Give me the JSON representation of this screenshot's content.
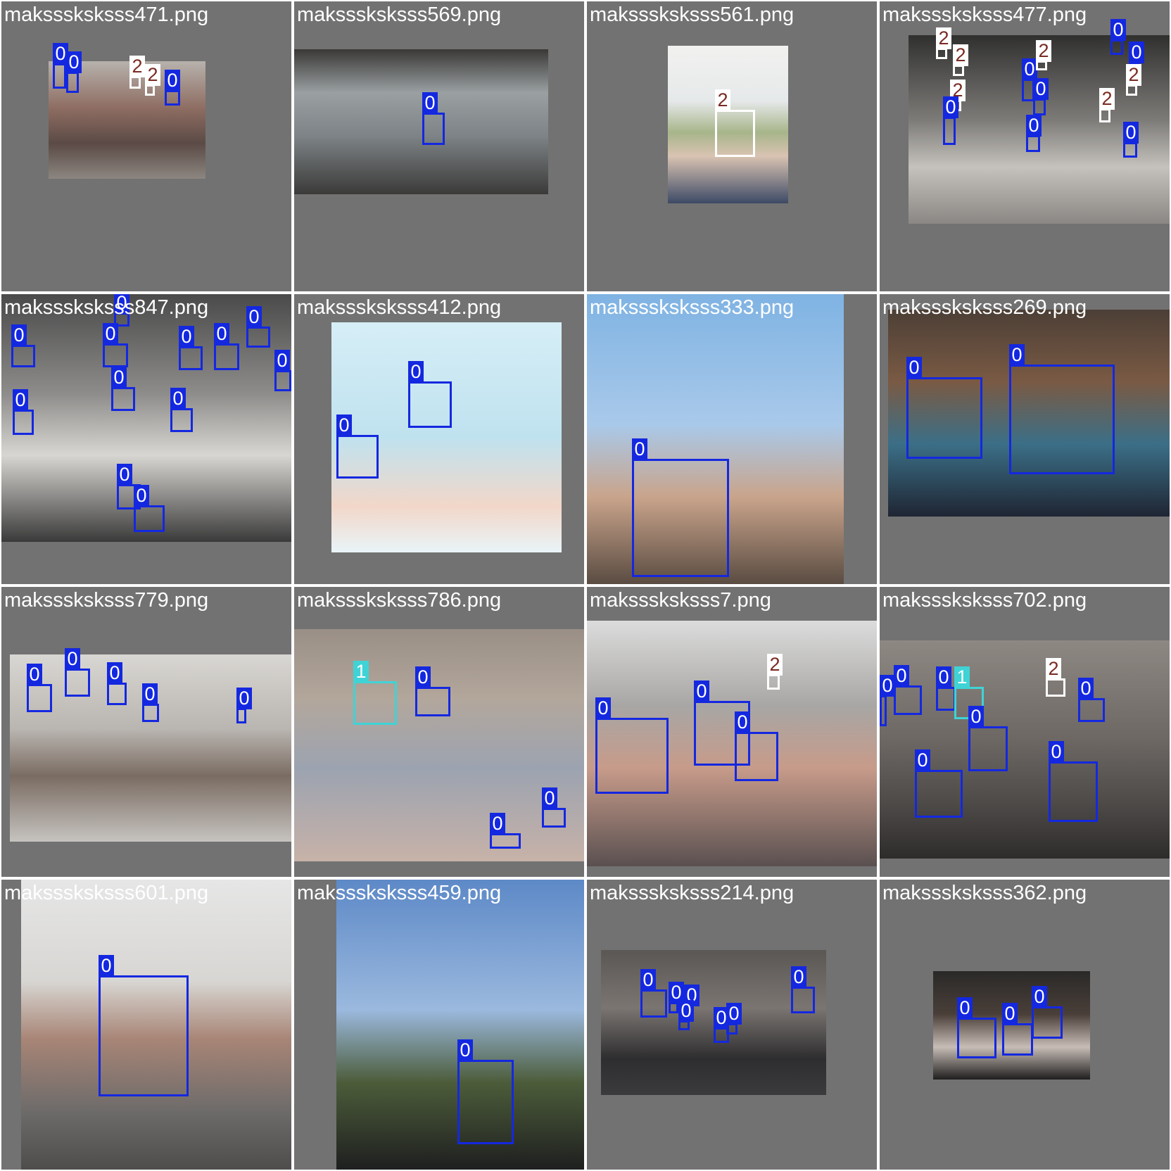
{
  "colors": {
    "class0": "#1428e0",
    "class1": "#3fd3d6",
    "class2": "#ffffff",
    "tile_bg": "#727272"
  },
  "tiles": [
    {
      "filename": "maksssksksss471.png",
      "photo_bg": "linear-gradient(180deg,#b7b2ad 0%,#8e6d62 40%,#5b4a45 70%,#8c8680 100%)",
      "boxes": [
        {
          "label": "0",
          "cls": 0
        },
        {
          "label": "0",
          "cls": 0
        },
        {
          "label": "2",
          "cls": 2
        },
        {
          "label": "2",
          "cls": 2
        },
        {
          "label": "0",
          "cls": 0
        }
      ]
    },
    {
      "filename": "maksssksksss569.png",
      "photo_bg": "linear-gradient(180deg,#3a3836 0%,#9aa0a2 30%,#7d8386 60%,#3b3a39 100%)",
      "boxes": [
        {
          "label": "0",
          "cls": 0
        }
      ]
    },
    {
      "filename": "maksssksksss561.png",
      "photo_bg": "linear-gradient(180deg,#f1f1ef 0%,#e6e9ea 35%,#a7b58a 55%,#d9c3b2 70%,#3d4a66 100%)",
      "boxes": [
        {
          "label": "2",
          "cls": 2
        }
      ]
    },
    {
      "filename": "maksssksksss477.png",
      "photo_bg": "linear-gradient(180deg,#30302f 0%,#7d7b78 45%,#c5c2bd 70%,#8a8784 100%)",
      "boxes": [
        {
          "label": "2",
          "cls": 2
        },
        {
          "label": "2",
          "cls": 2
        },
        {
          "label": "2",
          "cls": 2
        },
        {
          "label": "0",
          "cls": 0
        },
        {
          "label": "0",
          "cls": 0
        },
        {
          "label": "0",
          "cls": 0
        },
        {
          "label": "2",
          "cls": 2
        },
        {
          "label": "0",
          "cls": 0
        },
        {
          "label": "0",
          "cls": 0
        },
        {
          "label": "0",
          "cls": 0
        },
        {
          "label": "2",
          "cls": 2
        },
        {
          "label": "2",
          "cls": 2
        },
        {
          "label": "0",
          "cls": 0
        }
      ]
    },
    {
      "filename": "maksssksksss847.png",
      "photo_bg": "linear-gradient(180deg,#4a4a4a 0%,#8d8c8a 40%,#d8d6d2 65%,#3a3a3a 100%)",
      "boxes": [
        {
          "label": "0",
          "cls": 0
        },
        {
          "label": "0",
          "cls": 0
        },
        {
          "label": "0",
          "cls": 0
        },
        {
          "label": "0",
          "cls": 0
        },
        {
          "label": "0",
          "cls": 0
        },
        {
          "label": "0",
          "cls": 0
        },
        {
          "label": "0",
          "cls": 0
        },
        {
          "label": "0",
          "cls": 0
        },
        {
          "label": "0",
          "cls": 0
        },
        {
          "label": "0",
          "cls": 0
        },
        {
          "label": "0",
          "cls": 0
        },
        {
          "label": "0",
          "cls": 0
        },
        {
          "label": "0",
          "cls": 0
        }
      ]
    },
    {
      "filename": "maksssksksss412.png",
      "photo_bg": "linear-gradient(180deg,#d6eef6 0%,#bfe2ef 50%,#f2d7c9 80%,#e9f4f8 100%)",
      "boxes": [
        {
          "label": "0",
          "cls": 0
        },
        {
          "label": "0",
          "cls": 0
        }
      ]
    },
    {
      "filename": "maksssksksss333.png",
      "photo_bg": "linear-gradient(180deg,#7fb3e3 0%,#a9c9ea 45%,#c9a48b 70%,#5a4c42 100%)",
      "boxes": [
        {
          "label": "0",
          "cls": 0
        }
      ]
    },
    {
      "filename": "maksssksksss269.png",
      "photo_bg": "linear-gradient(180deg,#4c3f36 0%,#7a5a44 35%,#3b6f87 65%,#1f2533 100%)",
      "boxes": [
        {
          "label": "0",
          "cls": 0
        },
        {
          "label": "0",
          "cls": 0
        }
      ]
    },
    {
      "filename": "maksssksksss779.png",
      "photo_bg": "linear-gradient(180deg,#d9d7d3 0%,#b9b5b0 40%,#7a6c62 65%,#c6c3bf 100%)",
      "boxes": [
        {
          "label": "0",
          "cls": 0
        },
        {
          "label": "0",
          "cls": 0
        },
        {
          "label": "0",
          "cls": 0
        },
        {
          "label": "0",
          "cls": 0
        },
        {
          "label": "0",
          "cls": 0
        }
      ]
    },
    {
      "filename": "maksssksksss786.png",
      "photo_bg": "linear-gradient(180deg,#9a8f86 0%,#b3a79c 30%,#9ca3b0 60%,#c7b2a8 100%)",
      "boxes": [
        {
          "label": "1",
          "cls": 1
        },
        {
          "label": "0",
          "cls": 0
        },
        {
          "label": "0",
          "cls": 0
        },
        {
          "label": "0",
          "cls": 0
        }
      ]
    },
    {
      "filename": "maksssksksss7.png",
      "photo_bg": "linear-gradient(180deg,#dcdcdc 0%,#a8a6a4 35%,#c79b8a 60%,#5a5050 100%)",
      "boxes": [
        {
          "label": "0",
          "cls": 0
        },
        {
          "label": "0",
          "cls": 0
        },
        {
          "label": "0",
          "cls": 0
        },
        {
          "label": "2",
          "cls": 2
        }
      ]
    },
    {
      "filename": "maksssksksss702.png",
      "photo_bg": "linear-gradient(180deg,#8e8883 0%,#6d6864 45%,#4d4a48 75%,#2e2c2b 100%)",
      "boxes": [
        {
          "label": "0",
          "cls": 0
        },
        {
          "label": "0",
          "cls": 0
        },
        {
          "label": "0",
          "cls": 0
        },
        {
          "label": "1",
          "cls": 1
        },
        {
          "label": "0",
          "cls": 0
        },
        {
          "label": "2",
          "cls": 2
        },
        {
          "label": "0",
          "cls": 0
        },
        {
          "label": "0",
          "cls": 0
        },
        {
          "label": "0",
          "cls": 0
        }
      ]
    },
    {
      "filename": "maksssksksss601.png",
      "photo_bg": "linear-gradient(180deg,#e6e6e6 0%,#d8d6d3 35%,#a88576 55%,#6d6b6a 80%,#4e4d4c 100%)",
      "boxes": [
        {
          "label": "0",
          "cls": 0
        }
      ]
    },
    {
      "filename": "maksssksksss459.png",
      "photo_bg": "linear-gradient(180deg,#5d89c7 0%,#9bb9de 45%,#4c5c3a 70%,#1e1f1f 100%)",
      "boxes": [
        {
          "label": "0",
          "cls": 0
        }
      ]
    },
    {
      "filename": "maksssksksss214.png",
      "photo_bg": "linear-gradient(180deg,#5a5754 0%,#7b7572 40%,#2e2d2f 75%,#3b3a3c 100%)",
      "boxes": [
        {
          "label": "0",
          "cls": 0
        },
        {
          "label": "0",
          "cls": 0
        },
        {
          "label": "0",
          "cls": 0
        },
        {
          "label": "0",
          "cls": 0
        },
        {
          "label": "0",
          "cls": 0
        },
        {
          "label": "0",
          "cls": 0
        },
        {
          "label": "0",
          "cls": 0
        }
      ]
    },
    {
      "filename": "maksssksksss362.png",
      "photo_bg": "linear-gradient(180deg,#2a2928 0%,#4a3f39 40%,#c7bdb6 70%,#1f1e1e 100%)",
      "boxes": [
        {
          "label": "0",
          "cls": 0
        },
        {
          "label": "0",
          "cls": 0
        },
        {
          "label": "0",
          "cls": 0
        }
      ]
    }
  ]
}
